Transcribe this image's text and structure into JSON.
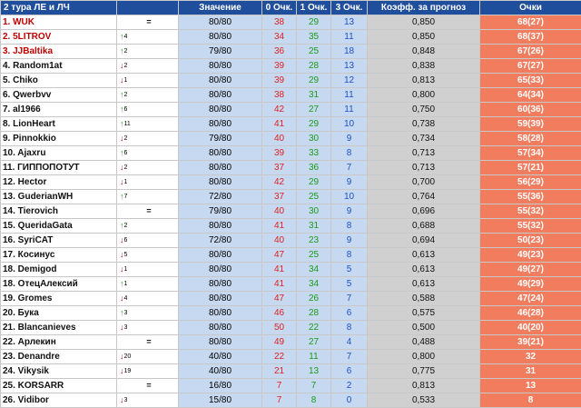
{
  "headers": {
    "name": "2 тура ЛЕ и ЛЧ",
    "value": "Значение",
    "zero": "0 Очк.",
    "one": "1 Очк.",
    "three": "3 Очк.",
    "coef": "Коэфф. за прогноз",
    "points": "Очки"
  },
  "colors": {
    "header_bg": "#1f4e9d",
    "value_bg": "#c6d9f1",
    "coef_bg": "#d0d0d0",
    "points_bg": "#f27c5e",
    "red": "#e02020",
    "green": "#1a9a1a",
    "blue": "#1f4ec8",
    "top_name": "#c00000"
  },
  "rows": [
    {
      "name": "1. WUK",
      "chg": "=",
      "dir": "eq",
      "val": "80/80",
      "z": "38",
      "o1": "29",
      "o3": "13",
      "coef": "0,850",
      "pts": "68(27)"
    },
    {
      "name": "2. 5LITROV",
      "chg": "4",
      "dir": "up",
      "val": "80/80",
      "z": "34",
      "o1": "35",
      "o3": "11",
      "coef": "0,850",
      "pts": "68(37)"
    },
    {
      "name": "3. JJBaltika",
      "chg": "2",
      "dir": "up",
      "val": "79/80",
      "z": "36",
      "o1": "25",
      "o3": "18",
      "coef": "0,848",
      "pts": "67(26)"
    },
    {
      "name": "4. Random1at",
      "chg": "2",
      "dir": "down",
      "val": "80/80",
      "z": "39",
      "o1": "28",
      "o3": "13",
      "coef": "0,838",
      "pts": "67(27)"
    },
    {
      "name": "5. Chiko",
      "chg": "1",
      "dir": "down",
      "val": "80/80",
      "z": "39",
      "o1": "29",
      "o3": "12",
      "coef": "0,813",
      "pts": "65(33)"
    },
    {
      "name": "6. Qwerbvv",
      "chg": "2",
      "dir": "up",
      "val": "80/80",
      "z": "38",
      "o1": "31",
      "o3": "11",
      "coef": "0,800",
      "pts": "64(34)"
    },
    {
      "name": "7. al1966",
      "chg": "6",
      "dir": "up",
      "val": "80/80",
      "z": "42",
      "o1": "27",
      "o3": "11",
      "coef": "0,750",
      "pts": "60(36)"
    },
    {
      "name": "8. LionHeart",
      "chg": "11",
      "dir": "up",
      "val": "80/80",
      "z": "41",
      "o1": "29",
      "o3": "10",
      "coef": "0,738",
      "pts": "59(39)"
    },
    {
      "name": "9. Pinnokkio",
      "chg": "2",
      "dir": "down",
      "val": "79/80",
      "z": "40",
      "o1": "30",
      "o3": "9",
      "coef": "0,734",
      "pts": "58(28)"
    },
    {
      "name": "10. Ajaxru",
      "chg": "6",
      "dir": "up",
      "val": "80/80",
      "z": "39",
      "o1": "33",
      "o3": "8",
      "coef": "0,713",
      "pts": "57(34)"
    },
    {
      "name": "11. ГИППОПОТУТ",
      "chg": "2",
      "dir": "down",
      "val": "80/80",
      "z": "37",
      "o1": "36",
      "o3": "7",
      "coef": "0,713",
      "pts": "57(21)"
    },
    {
      "name": "12. Hector",
      "chg": "1",
      "dir": "down",
      "val": "80/80",
      "z": "42",
      "o1": "29",
      "o3": "9",
      "coef": "0,700",
      "pts": "56(29)"
    },
    {
      "name": "13. GuderianWH",
      "chg": "7",
      "dir": "up",
      "val": "72/80",
      "z": "37",
      "o1": "25",
      "o3": "10",
      "coef": "0,764",
      "pts": "55(36)"
    },
    {
      "name": "14. Tierovich",
      "chg": "=",
      "dir": "eq",
      "val": "79/80",
      "z": "40",
      "o1": "30",
      "o3": "9",
      "coef": "0,696",
      "pts": "55(32)"
    },
    {
      "name": "15. QueridaGata",
      "chg": "2",
      "dir": "up",
      "val": "80/80",
      "z": "41",
      "o1": "31",
      "o3": "8",
      "coef": "0,688",
      "pts": "55(32)"
    },
    {
      "name": "16. SyriCAT",
      "chg": "6",
      "dir": "down",
      "val": "72/80",
      "z": "40",
      "o1": "23",
      "o3": "9",
      "coef": "0,694",
      "pts": "50(23)"
    },
    {
      "name": "17. Косинус",
      "chg": "5",
      "dir": "down",
      "val": "80/80",
      "z": "47",
      "o1": "25",
      "o3": "8",
      "coef": "0,613",
      "pts": "49(23)"
    },
    {
      "name": "18. Demigod",
      "chg": "1",
      "dir": "down",
      "val": "80/80",
      "z": "41",
      "o1": "34",
      "o3": "5",
      "coef": "0,613",
      "pts": "49(27)"
    },
    {
      "name": "18. ОтецАлексий",
      "chg": "1",
      "dir": "up",
      "val": "80/80",
      "z": "41",
      "o1": "34",
      "o3": "5",
      "coef": "0,613",
      "pts": "49(29)"
    },
    {
      "name": "19. Gromes",
      "chg": "4",
      "dir": "down",
      "val": "80/80",
      "z": "47",
      "o1": "26",
      "o3": "7",
      "coef": "0,588",
      "pts": "47(24)"
    },
    {
      "name": "20. Бука",
      "chg": "3",
      "dir": "up",
      "val": "80/80",
      "z": "46",
      "o1": "28",
      "o3": "6",
      "coef": "0,575",
      "pts": "46(28)"
    },
    {
      "name": "21. Blancanieves",
      "chg": "3",
      "dir": "down",
      "val": "80/80",
      "z": "50",
      "o1": "22",
      "o3": "8",
      "coef": "0,500",
      "pts": "40(20)"
    },
    {
      "name": "22. Арлекин",
      "chg": "=",
      "dir": "eq",
      "val": "80/80",
      "z": "49",
      "o1": "27",
      "o3": "4",
      "coef": "0,488",
      "pts": "39(21)"
    },
    {
      "name": "23. Denandre",
      "chg": "20",
      "dir": "down",
      "val": "40/80",
      "z": "22",
      "o1": "11",
      "o3": "7",
      "coef": "0,800",
      "pts": "32"
    },
    {
      "name": "24. Vikysik",
      "chg": "19",
      "dir": "down",
      "val": "40/80",
      "z": "21",
      "o1": "13",
      "o3": "6",
      "coef": "0,775",
      "pts": "31"
    },
    {
      "name": "25. KORSARR",
      "chg": "=",
      "dir": "eq",
      "val": "16/80",
      "z": "7",
      "o1": "7",
      "o3": "2",
      "coef": "0,813",
      "pts": "13"
    },
    {
      "name": "26. Vidibor",
      "chg": "3",
      "dir": "down",
      "val": "15/80",
      "z": "7",
      "o1": "8",
      "o3": "0",
      "coef": "0,533",
      "pts": "8"
    }
  ]
}
